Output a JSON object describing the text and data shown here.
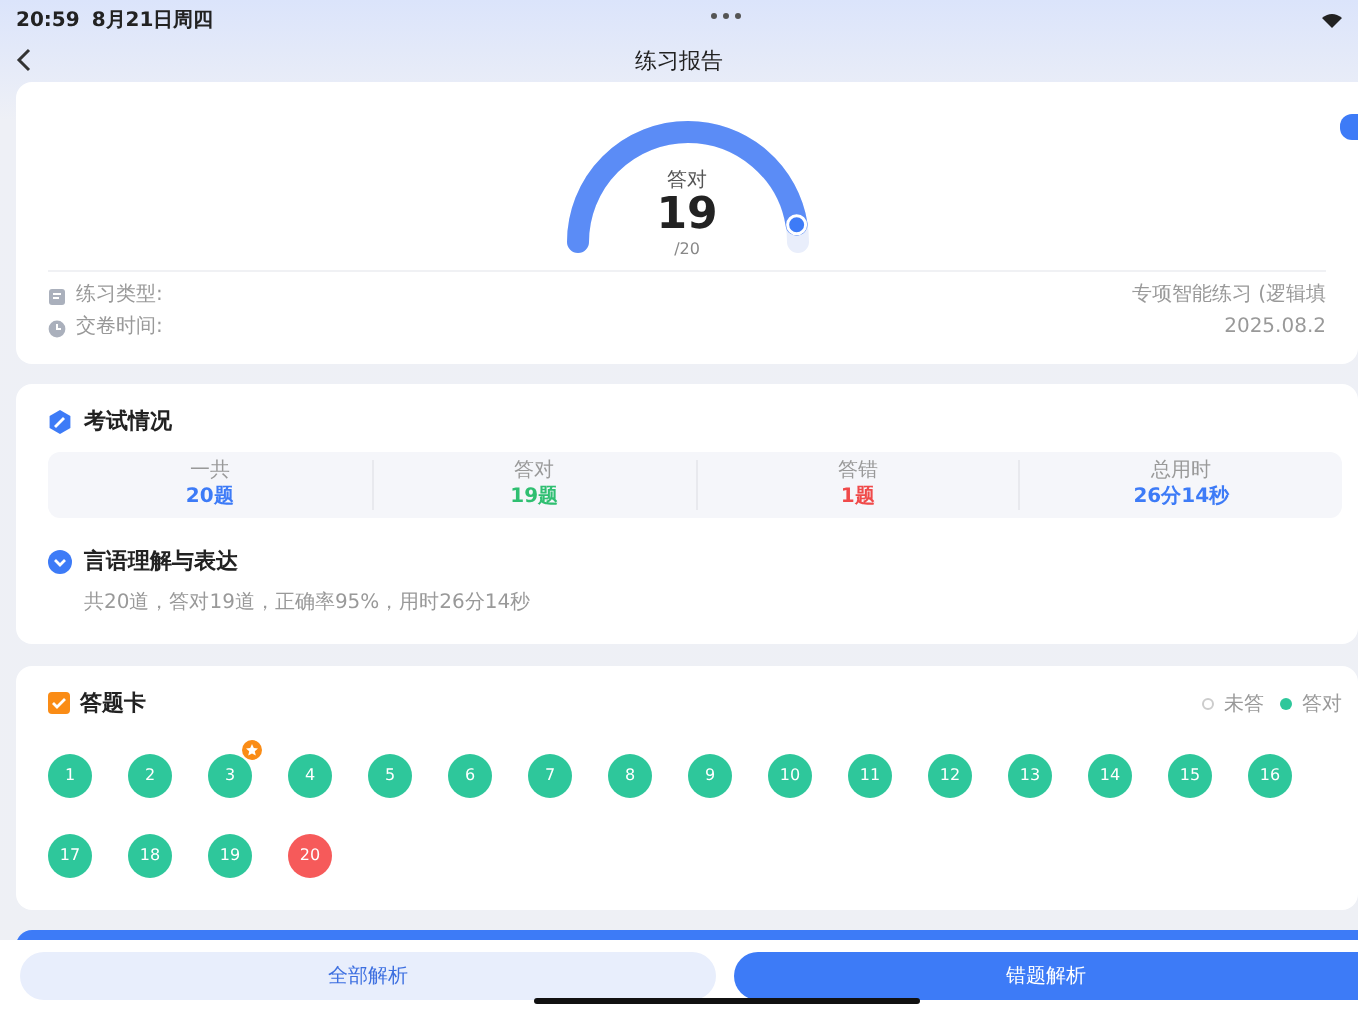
{
  "status_bar": {
    "time": "20:59",
    "date": "8月21日周四"
  },
  "nav": {
    "title": "练习报告"
  },
  "score": {
    "label": "答对",
    "value": "19",
    "total": "/20",
    "level": 0.95
  },
  "info": [
    {
      "kind": "type",
      "label": "练习类型:",
      "value": "专项智能练习 (逻辑填"
    },
    {
      "kind": "time",
      "label": "交卷时间:",
      "value": "2025.08.2"
    }
  ],
  "exam": {
    "title": "考试情况",
    "stats": [
      {
        "kind": "total",
        "label": "一共",
        "value": "20题"
      },
      {
        "kind": "correct",
        "label": "答对",
        "value": "19题"
      },
      {
        "kind": "wrong",
        "label": "答错",
        "value": "1题"
      },
      {
        "kind": "total",
        "label": "总用时",
        "value": "26分14秒"
      }
    ],
    "section": {
      "title": "言语理解与表达",
      "summary": "共20道，答对19道，正确率95%，用时26分14秒",
      "expanded": true
    }
  },
  "answer_card": {
    "title": "答题卡",
    "legend": [
      {
        "kind": "unanswered",
        "label": "未答"
      },
      {
        "kind": "correct",
        "label": "答对"
      }
    ],
    "items": [
      {
        "number": "1",
        "kind": "correct",
        "starred": false
      },
      {
        "number": "2",
        "kind": "correct",
        "starred": false
      },
      {
        "number": "3",
        "kind": "correct",
        "starred": true
      },
      {
        "number": "4",
        "kind": "correct",
        "starred": false
      },
      {
        "number": "5",
        "kind": "correct",
        "starred": false
      },
      {
        "number": "6",
        "kind": "correct",
        "starred": false
      },
      {
        "number": "7",
        "kind": "correct",
        "starred": false
      },
      {
        "number": "8",
        "kind": "correct",
        "starred": false
      },
      {
        "number": "9",
        "kind": "correct",
        "starred": false
      },
      {
        "number": "10",
        "kind": "correct",
        "starred": false
      },
      {
        "number": "11",
        "kind": "correct",
        "starred": false
      },
      {
        "number": "12",
        "kind": "correct",
        "starred": false
      },
      {
        "number": "13",
        "kind": "correct",
        "starred": false
      },
      {
        "number": "14",
        "kind": "correct",
        "starred": false
      },
      {
        "number": "15",
        "kind": "correct",
        "starred": false
      },
      {
        "number": "16",
        "kind": "correct",
        "starred": false
      },
      {
        "number": "17",
        "kind": "correct",
        "starred": false
      },
      {
        "number": "18",
        "kind": "correct",
        "starred": false
      },
      {
        "number": "19",
        "kind": "correct",
        "starred": false
      },
      {
        "number": "20",
        "kind": "wrong",
        "starred": false
      }
    ]
  },
  "buttons": [
    {
      "label": "全部解析",
      "kind": "secondary"
    },
    {
      "label": "错题解析",
      "kind": "primary"
    }
  ]
}
